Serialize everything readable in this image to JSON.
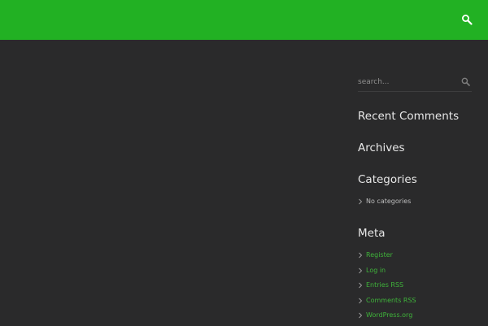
{
  "header": {
    "search_icon": "search-icon",
    "color": "#22b123"
  },
  "sidebar": {
    "search": {
      "placeholder": "search...",
      "icon": "search-icon"
    },
    "recent_comments_title": "Recent Comments",
    "archives_title": "Archives",
    "categories": {
      "title": "Categories",
      "items": [
        "No categories"
      ]
    },
    "meta": {
      "title": "Meta",
      "items": [
        "Register",
        "Log in",
        "Entries RSS",
        "Comments RSS",
        "WordPress.org"
      ]
    }
  },
  "colors": {
    "background": "#2a2a2b",
    "accent": "#22b123",
    "link": "#3fb43a"
  }
}
